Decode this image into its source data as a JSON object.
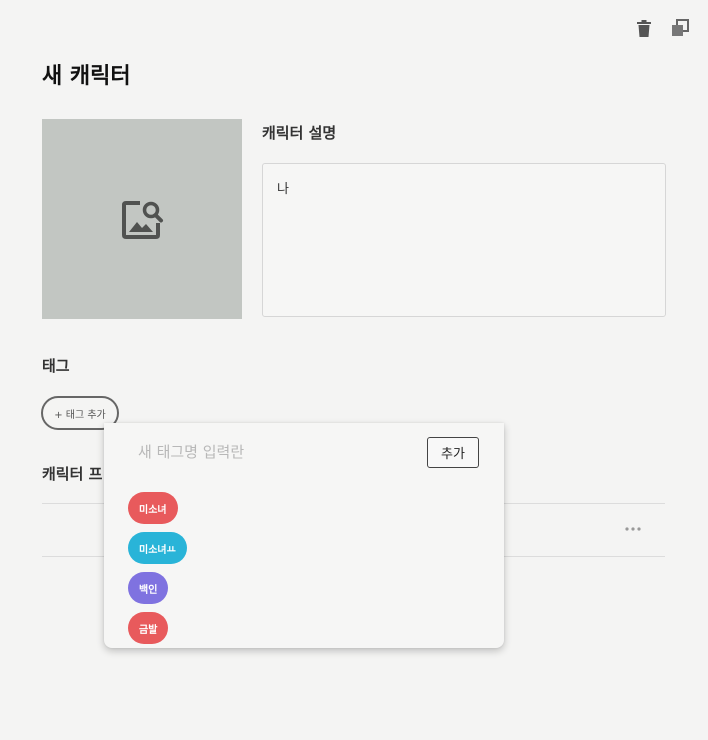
{
  "header": {
    "title": "새 캐릭터",
    "icons": [
      "trash-icon",
      "duplicate-icon"
    ]
  },
  "image": {
    "icon": "image-search-icon"
  },
  "description": {
    "label": "캐릭터 설명",
    "value": "나"
  },
  "tags": {
    "label": "태그",
    "add_label": "+ 태그 추가",
    "popover": {
      "placeholder": "새 태그명 입력란",
      "add_button": "추가",
      "items": [
        {
          "label": "미소녀",
          "color": "#e85a5c"
        },
        {
          "label": "미소녀ㅛ",
          "color": "#29b4d8"
        },
        {
          "label": "백인",
          "color": "#7f72e0"
        },
        {
          "label": "금발",
          "color": "#e85a5c"
        }
      ]
    }
  },
  "profile": {
    "label": "캐릭터 프",
    "more_icon": "more-horizontal-icon"
  }
}
